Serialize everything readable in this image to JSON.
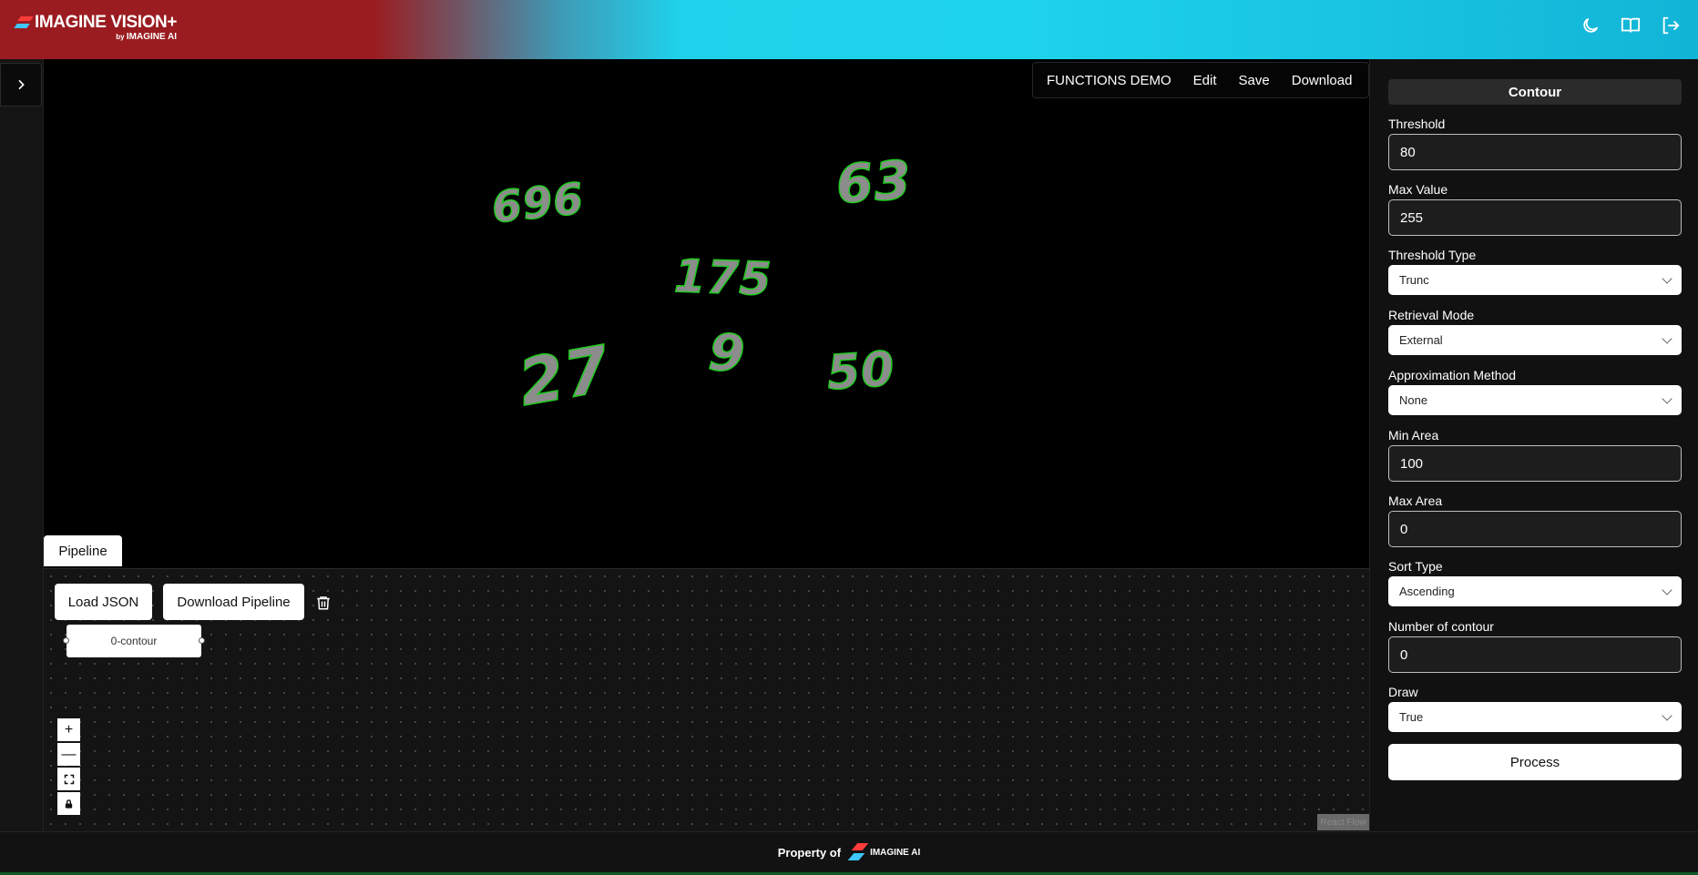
{
  "header": {
    "brand": "IMAGINE VISION+",
    "brand_sub_prefix": "by",
    "brand_sub": "IMAGINE AI",
    "icons": [
      "moon-icon",
      "book-icon",
      "logout-icon"
    ]
  },
  "toolbar": {
    "title": "FUNCTIONS DEMO",
    "edit": "Edit",
    "save": "Save",
    "download": "Download"
  },
  "canvas": {
    "numbers": [
      "696",
      "63",
      "175",
      "27",
      "9",
      "50"
    ],
    "contour_color": "#1fcc1f",
    "fill_color": "#8c8c8c"
  },
  "pipeline": {
    "tab": "Pipeline",
    "load_json": "Load JSON",
    "download_pipeline": "Download Pipeline",
    "node": "0-contour",
    "zoom_in": "+",
    "zoom_out": "—",
    "attribution": "React Flow"
  },
  "panel": {
    "title": "Contour",
    "threshold": {
      "label": "Threshold",
      "value": "80"
    },
    "max_value": {
      "label": "Max Value",
      "value": "255"
    },
    "threshold_type": {
      "label": "Threshold Type",
      "value": "Trunc"
    },
    "retrieval_mode": {
      "label": "Retrieval Mode",
      "value": "External"
    },
    "approximation_method": {
      "label": "Approximation Method",
      "value": "None"
    },
    "min_area": {
      "label": "Min Area",
      "value": "100"
    },
    "max_area": {
      "label": "Max Area",
      "value": "0"
    },
    "sort_type": {
      "label": "Sort Type",
      "value": "Ascending"
    },
    "number_of_contour": {
      "label": "Number of contour",
      "value": "0"
    },
    "draw": {
      "label": "Draw",
      "value": "True"
    },
    "process": "Process"
  },
  "footer": {
    "text": "Property of",
    "logo_text": "IMAGINE AI"
  }
}
